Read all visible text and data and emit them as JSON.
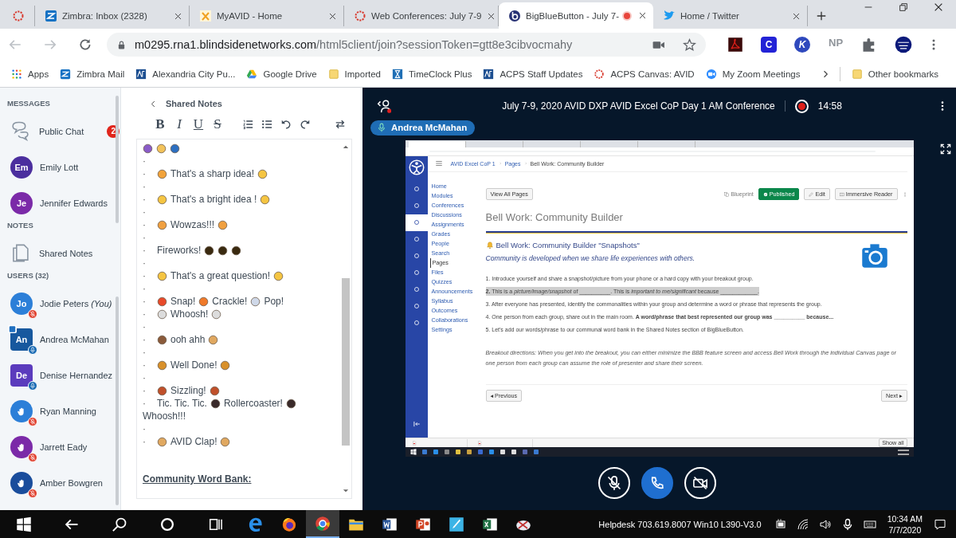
{
  "browser": {
    "tabs": [
      {
        "kind": "ring",
        "pinned": true,
        "selected": false,
        "recording": false
      },
      {
        "kind": "zimbra",
        "title": "Zimbra: Inbox (2328)",
        "pinned": false,
        "selected": false,
        "recording": false
      },
      {
        "kind": "avid",
        "title": "MyAVID - Home",
        "pinned": false,
        "selected": false,
        "recording": false
      },
      {
        "kind": "ring",
        "title": "Web Conferences: July 7-9",
        "pinned": false,
        "selected": false,
        "recording": false
      },
      {
        "kind": "bbb",
        "title": "BigBlueButton - July 7-",
        "pinned": false,
        "selected": true,
        "recording": true
      },
      {
        "kind": "bird",
        "title": "Home / Twitter",
        "pinned": false,
        "selected": false,
        "recording": false
      }
    ],
    "address": {
      "host": "m0295.rna1.blindsidenetworks.com",
      "path": "/html5client/join?sessionToken=gtt8e3cibvocmahy"
    },
    "extensions": [
      {
        "kind": "pdf"
      },
      {
        "kind": "square",
        "label": "C"
      },
      {
        "kind": "round",
        "label": "K"
      },
      {
        "kind": "plain",
        "label": "NP"
      },
      {
        "kind": "puzzle"
      },
      {
        "kind": "avatar"
      }
    ],
    "bookmarks": [
      {
        "kind": "apps",
        "label": "Apps"
      },
      {
        "kind": "zimbra",
        "label": "Zimbra Mail"
      },
      {
        "kind": "acps",
        "label": "Alexandria City Pu..."
      },
      {
        "kind": "drive",
        "label": "Google Drive"
      },
      {
        "kind": "folder",
        "label": "Imported"
      },
      {
        "kind": "hourglass",
        "label": "TimeClock Plus"
      },
      {
        "kind": "acps",
        "label": "ACPS Staff Updates"
      },
      {
        "kind": "ring",
        "label": "ACPS Canvas: AVID"
      },
      {
        "kind": "zoom",
        "label": "My Zoom Meetings"
      }
    ],
    "other_bookmarks": "Other bookmarks"
  },
  "sidebar": {
    "messages_heading": "MESSAGES",
    "public_chat": {
      "label": "Public Chat",
      "badge": "2"
    },
    "chats": [
      {
        "initials": "Em",
        "name": "Emily Lott",
        "color": "#4b2e9e"
      },
      {
        "initials": "Je",
        "name": "Jennifer Edwards",
        "color": "#7b2aa8"
      }
    ],
    "notes_heading": "NOTES",
    "shared_notes": "Shared Notes",
    "users_heading": "USERS (32)",
    "users": [
      {
        "initials": "Jo",
        "name": "Jodie Peters",
        "you": "(You)",
        "color": "#2c7fd8",
        "moderator": false,
        "hand": false,
        "muted": true,
        "presenter": false
      },
      {
        "initials": "An",
        "name": "Andrea McMahan",
        "color": "#17589e",
        "moderator": true,
        "hand": false,
        "muted": false,
        "presenter": true
      },
      {
        "initials": "De",
        "name": "Denise Hernandez",
        "color": "#5b3bbd",
        "moderator": true,
        "hand": false,
        "muted": false,
        "presenter": false
      },
      {
        "name": "Ryan Manning",
        "color": "#2c7fd8",
        "moderator": false,
        "hand": true,
        "muted": true,
        "presenter": false
      },
      {
        "name": "Jarrett Eady",
        "color": "#7b2aa8",
        "moderator": false,
        "hand": true,
        "muted": true,
        "presenter": false
      },
      {
        "name": "Amber Bowgren",
        "color": "#1a4d9c",
        "moderator": false,
        "hand": true,
        "muted": true,
        "presenter": false
      }
    ]
  },
  "notes": {
    "title": "Shared Notes",
    "toolbar": [
      "B",
      "I",
      "U",
      "S"
    ],
    "lines": [
      {
        "parts": [
          {
            "kind": "emoji",
            "color": "#8a5cc8"
          },
          {
            "kind": "emoji",
            "color": "#f2c25a"
          },
          {
            "kind": "emoji",
            "color": "#2d6fc0"
          }
        ]
      },
      {
        "bullet": "·"
      },
      {
        "bullet": "·",
        "parts": [
          {
            "kind": "emoji",
            "color": "#f2a33a"
          },
          {
            "kind": "text",
            "text": "That's a sharp idea!"
          },
          {
            "kind": "emoji",
            "color": "#f5c542"
          }
        ]
      },
      {
        "bullet": "·"
      },
      {
        "bullet": "·",
        "parts": [
          {
            "kind": "emoji",
            "color": "#f5c542"
          },
          {
            "kind": "text",
            "text": "That's a bright idea !"
          },
          {
            "kind": "emoji",
            "color": "#f5c542"
          }
        ]
      },
      {
        "bullet": "·"
      },
      {
        "bullet": "·",
        "parts": [
          {
            "kind": "emoji",
            "color": "#f0a040"
          },
          {
            "kind": "text",
            "text": "Wowzas!!!"
          },
          {
            "kind": "emoji",
            "color": "#f0a040"
          }
        ]
      },
      {
        "bullet": "·"
      },
      {
        "bullet": "·",
        "parts": [
          {
            "kind": "text",
            "text": "Fireworks!"
          },
          {
            "kind": "emoji",
            "color": "#3a2a10"
          },
          {
            "kind": "emoji",
            "color": "#3a2a10"
          },
          {
            "kind": "emoji",
            "color": "#3a2a10"
          }
        ]
      },
      {
        "bullet": "·"
      },
      {
        "bullet": "·",
        "parts": [
          {
            "kind": "emoji",
            "color": "#f5c542"
          },
          {
            "kind": "text",
            "text": "That's a great question!"
          },
          {
            "kind": "emoji",
            "color": "#f5c542"
          }
        ]
      },
      {
        "bullet": "·"
      },
      {
        "bullet": "·",
        "parts": [
          {
            "kind": "emoji",
            "color": "#e84a2a"
          },
          {
            "kind": "text",
            "text": "Snap!"
          },
          {
            "kind": "emoji",
            "color": "#f07a2a"
          },
          {
            "kind": "text",
            "text": "Crackle!"
          },
          {
            "kind": "emoji",
            "color": "#cfd8e8"
          },
          {
            "kind": "text",
            "text": "Pop!"
          }
        ]
      },
      {
        "bullet": "·",
        "parts": [
          {
            "kind": "emoji",
            "color": "#dcdcdc"
          },
          {
            "kind": "text",
            "text": "Whoosh!"
          },
          {
            "kind": "emoji",
            "color": "#dcdcdc"
          }
        ]
      },
      {
        "bullet": "·"
      },
      {
        "bullet": "·",
        "parts": [
          {
            "kind": "emoji",
            "color": "#8a5a3a"
          },
          {
            "kind": "text",
            "text": "ooh ahh"
          },
          {
            "kind": "emoji",
            "color": "#e0a860"
          }
        ]
      },
      {
        "bullet": "·"
      },
      {
        "bullet": "·",
        "parts": [
          {
            "kind": "emoji",
            "color": "#d8902a"
          },
          {
            "kind": "text",
            "text": "Well Done!"
          },
          {
            "kind": "emoji",
            "color": "#d8902a"
          }
        ]
      },
      {
        "bullet": "·"
      },
      {
        "bullet": "·",
        "parts": [
          {
            "kind": "emoji",
            "color": "#c0502a"
          },
          {
            "kind": "text",
            "text": "Sizzling!"
          },
          {
            "kind": "emoji",
            "color": "#c0502a"
          }
        ]
      },
      {
        "bullet": "·",
        "parts": [
          {
            "kind": "text",
            "text": "Tic. Tic.  Tic."
          },
          {
            "kind": "emoji",
            "color": "#3a2a2a"
          },
          {
            "kind": "text",
            "text": "Rollercoaster!"
          },
          {
            "kind": "emoji",
            "color": "#3a2a2a"
          }
        ]
      },
      {
        "parts": [
          {
            "kind": "text",
            "text": "Whoosh!!!"
          }
        ]
      },
      {
        "bullet": "·"
      },
      {
        "bullet": "·",
        "parts": [
          {
            "kind": "emoji",
            "color": "#e0a860"
          },
          {
            "kind": "text",
            "text": "AVID Clap!"
          },
          {
            "kind": "emoji",
            "color": "#e0a860"
          }
        ]
      }
    ],
    "footer": "Community Word Bank:"
  },
  "presentation": {
    "title": "July 7-9, 2020 AVID DXP AVID Excel CoP Day 1 AM Conference",
    "recording": true,
    "timer": "14:58",
    "presenter": "Andrea McMahan",
    "controls": [
      {
        "kind": "mic",
        "on": false
      },
      {
        "kind": "phone",
        "on": true
      },
      {
        "kind": "camera",
        "on": false
      }
    ]
  },
  "screen": {
    "tabs": [
      {
        "selected": true
      },
      {
        "selected": false
      },
      {
        "selected": false
      },
      {
        "selected": false
      },
      {
        "selected": false
      }
    ],
    "global_nav": [
      {
        "selected": false
      },
      {
        "selected": false
      },
      {
        "selected": true
      },
      {
        "selected": false
      },
      {
        "selected": false
      },
      {
        "selected": false
      },
      {
        "selected": false
      },
      {
        "selected": false
      },
      {
        "selected": false
      }
    ],
    "breadcrumb": [
      "AVID Excel CoP 1",
      "Pages",
      "Bell Work: Community Builder"
    ],
    "course_nav": [
      {
        "label": "Home",
        "selected": false
      },
      {
        "label": "Modules",
        "selected": false
      },
      {
        "label": "Conferences",
        "selected": false
      },
      {
        "label": "Discussions",
        "selected": false
      },
      {
        "label": "Assignments",
        "selected": false
      },
      {
        "label": "Grades",
        "selected": false
      },
      {
        "label": "People",
        "selected": false
      },
      {
        "label": "Search",
        "selected": false
      },
      {
        "label": "Pages",
        "selected": true
      },
      {
        "label": "Files",
        "selected": false
      },
      {
        "label": "Quizzes",
        "selected": false
      },
      {
        "label": "Announcements",
        "selected": false
      },
      {
        "label": "Syllabus",
        "selected": false
      },
      {
        "label": "Outcomes",
        "selected": false
      },
      {
        "label": "Collaborations",
        "selected": false
      },
      {
        "label": "Settings",
        "selected": false
      }
    ],
    "view_all": "View All Pages",
    "blueprint": "Blueprint",
    "published": "Published",
    "edit": "Edit",
    "reader": "Immersive Reader",
    "page_title": "Bell Work: Community Builder",
    "heading": "Bell Work: Community Builder \"Snapshots\"",
    "subtitle": "Community is developed when we share life experiences with others.",
    "steps": [
      {
        "text": "1. Introduce yourself and share a snapshot/picture from your phone or a hard copy with your breakout group.",
        "highlighted": false
      },
      {
        "text": "**2.** This is a *picture/image/snapshot* of __________. This is *important to me/significant* because ____________.",
        "highlighted": true
      },
      {
        "text": "3. After everyone has presented, identify the commonalities within your group and determine a word or phrase that represents the group.",
        "highlighted": false
      },
      {
        "text": "4. One person from each group, share out in the main room. **A word/phrase that best represented our group was __________ because...**",
        "highlighted": false
      },
      {
        "text": "5. Let's add our words/phrase to our communal word bank in the Shared Notes section of BigBlueButton.",
        "highlighted": false
      }
    ],
    "directions": "Breakout directions: When you get into the breakout, you can either minimize the BBB feature screen and access Bell Work through the individual Canvas page or one person from each group can assume the role of presenter and share their screen.",
    "previous": "◂ Previous",
    "next": "Next ▸",
    "show_all": "Show all"
  },
  "taskbar": {
    "apps": [
      {
        "kind": "start",
        "active": false
      },
      {
        "kind": "back",
        "active": false
      },
      {
        "kind": "search",
        "active": false
      },
      {
        "kind": "cortana",
        "active": false
      },
      {
        "kind": "taskview",
        "active": false
      },
      {
        "kind": "edge",
        "active": false
      },
      {
        "kind": "firefox",
        "active": false
      },
      {
        "kind": "chrome",
        "active": true
      },
      {
        "kind": "explorer",
        "active": false
      },
      {
        "kind": "word",
        "active": false
      },
      {
        "kind": "powerpoint",
        "active": false
      },
      {
        "kind": "notes",
        "active": false
      },
      {
        "kind": "excel",
        "active": false
      },
      {
        "kind": "snip",
        "active": false
      }
    ],
    "helpdesk": "Helpdesk 703.619.8007 Win10 L390-V3.0",
    "time": "10:34 AM",
    "date": "7/7/2020"
  }
}
